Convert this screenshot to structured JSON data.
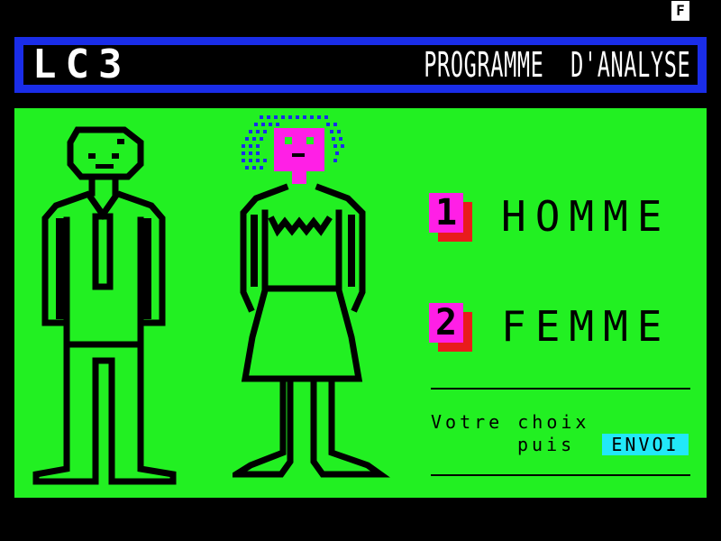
{
  "status": {
    "indicator": "F"
  },
  "header": {
    "brand": "LC3",
    "title": "PROGRAMME  D'ANALYSE"
  },
  "menu": {
    "options": [
      {
        "key": "1",
        "label": "HOMME"
      },
      {
        "key": "2",
        "label": "FEMME"
      }
    ]
  },
  "prompt": {
    "line1": "Votre choix",
    "line2": "puis",
    "send_key": "ENVOI"
  },
  "colors": {
    "background": "#000000",
    "panel": "#22f022",
    "header_border": "#1a2de8",
    "key_face": "#ff1fe6",
    "key_shadow": "#e81c1c",
    "send_key": "#22e8f8",
    "hair": "#1a2de8"
  },
  "illustrations": {
    "left": "man-figure",
    "right": "woman-figure"
  }
}
